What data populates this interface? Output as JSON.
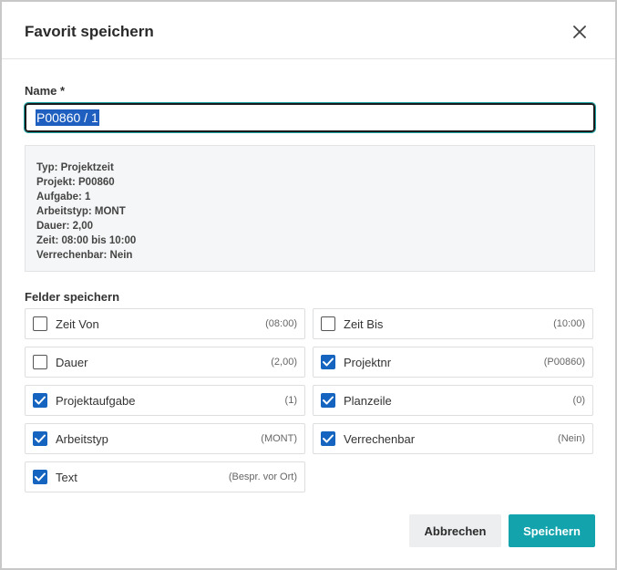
{
  "dialog": {
    "title": "Favorit speichern",
    "close_icon": "close-icon"
  },
  "name": {
    "label": "Name *",
    "value": "P00860 / 1"
  },
  "info": {
    "lines": [
      "Typ: Projektzeit",
      "Projekt: P00860",
      "Aufgabe: 1",
      "Arbeitstyp: MONT",
      "Dauer: 2,00",
      "Zeit: 08:00 bis 10:00",
      "Verrechenbar: Nein"
    ]
  },
  "fields": {
    "label": "Felder speichern",
    "items": [
      {
        "label": "Zeit Von",
        "value": "(08:00)",
        "checked": false
      },
      {
        "label": "Zeit Bis",
        "value": "(10:00)",
        "checked": false
      },
      {
        "label": "Dauer",
        "value": "(2,00)",
        "checked": false
      },
      {
        "label": "Projektnr",
        "value": "(P00860)",
        "checked": true
      },
      {
        "label": "Projektaufgabe",
        "value": "(1)",
        "checked": true
      },
      {
        "label": "Planzeile",
        "value": "(0)",
        "checked": true
      },
      {
        "label": "Arbeitstyp",
        "value": "(MONT)",
        "checked": true
      },
      {
        "label": "Verrechenbar",
        "value": "(Nein)",
        "checked": true
      },
      {
        "label": "Text",
        "value": "(Bespr. vor Ort)",
        "checked": true
      }
    ]
  },
  "buttons": {
    "cancel": "Abbrechen",
    "save": "Speichern"
  },
  "colors": {
    "accent": "#12a3ac",
    "checkbox": "#1565c0"
  }
}
